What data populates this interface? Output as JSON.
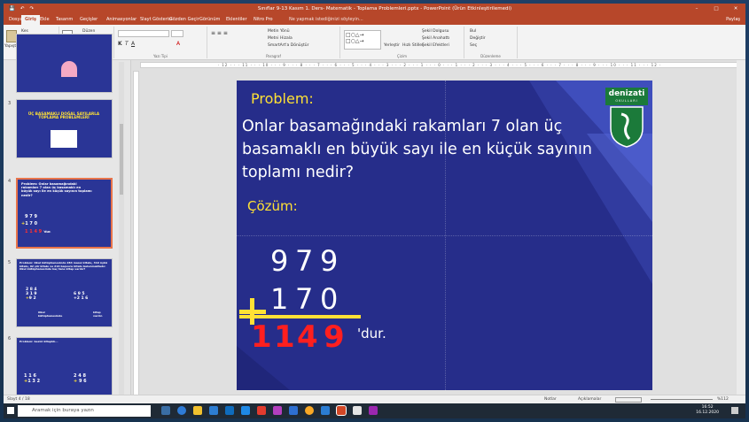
{
  "window": {
    "title": "Sınıflar 9-13 Kasım 1. Ders- Matematik - Toplama Problemleri.pptx - PowerPoint (Ürün Etkinleştirilemedi)",
    "search_hint": "Ne yapmak istediğinizi söyleyin..."
  },
  "tabs": [
    "Dosya",
    "Giriş",
    "Ekle",
    "Tasarım",
    "Geçişler",
    "Animasyonlar",
    "Slayt Gösterisi",
    "Gözden Geçir",
    "Görünüm",
    "Eklentiler",
    "Nitro Pro"
  ],
  "active_tab": "Giriş",
  "share_label": "Paylaş",
  "ribbon": {
    "groups": [
      "Pano",
      "Slaytlar",
      "Yazı Tipi",
      "Paragraf",
      "Çizim",
      "Düzenleme"
    ],
    "clipboard": {
      "paste": "Yapıştır",
      "cut": "Kes",
      "copy": "Kopyala",
      "format": "Biçim Boyacısı"
    },
    "slides": {
      "new": "Yeni Slayt",
      "layout": "Düzen",
      "reset": "Sıfırla",
      "section": "Bölüm"
    },
    "paragraph": {
      "text_dir": "Metin Yönü",
      "align": "Metni Hizala",
      "smartart": "SmartArt'a Dönüştür"
    },
    "drawing": {
      "arrange": "Yerleştir",
      "styles": "Hızlı Stiller",
      "fill": "Şekil Dolgusu",
      "outline": "Şekil Anahattı",
      "effects": "Şekil Efektleri"
    },
    "editing": {
      "find": "Bul",
      "replace": "Değiştir",
      "select": "Seç"
    }
  },
  "thumbnails": [
    {
      "num": "",
      "title": ""
    },
    {
      "num": "3",
      "title": "ÜÇ BASAMAKLI DOĞAL SAYILARLA TOPLAMA PROBLEMLERİ"
    },
    {
      "num": "4",
      "title": "Problem: Onlar basamağındaki rakamları 7 olan üç basamaklı en büyük sayı ile en küçük sayının toplamı nedir?"
    },
    {
      "num": "5",
      "title": "Problem: Okul kütüphanesinde 284 masal kitabı, 319 öykü kitabı, 92 şiir kitabı ve 216 başvuru kitabı bulunmaktadır. Okul kütüphanesinde kaç tane kitap vardır?"
    },
    {
      "num": "6",
      "title": "Problem: Gezici kitaplık..."
    }
  ],
  "thumb5": {
    "a": [
      "2 8 4",
      "3 1 9",
      "9 2"
    ],
    "b": [
      "6 9 5",
      "+2 1 6"
    ],
    "l1": "Okul kütüphanesinde",
    "l2": "kitap vardır."
  },
  "thumb6": {
    "a": [
      "1 1 6",
      "1 3 2"
    ],
    "b": [
      "2 4 8",
      "9 6"
    ]
  },
  "slide": {
    "problem_label": "Problem:",
    "question": "Onlar basamağındaki rakamları 7 olan üç basamaklı en büyük sayı ile en küçük sayının toplamı nedir?",
    "solution_label": "Çözüm:",
    "addend1": [
      "9",
      "7",
      "9"
    ],
    "addend2": [
      "1",
      "7",
      "0"
    ],
    "sum": [
      "1",
      "1",
      "4",
      "9"
    ],
    "suffix": "'dur.",
    "logo_text": "denizati",
    "logo_sub": "OKULLARI"
  },
  "status": {
    "slide_info": "Slayt 4 / 18",
    "notes": "Notlar",
    "comments": "Açıklamalar",
    "zoom": "%112"
  },
  "taskbar": {
    "search_placeholder": "Aramak için buraya yazın",
    "time": "16:52",
    "date": "16.12.2020"
  }
}
